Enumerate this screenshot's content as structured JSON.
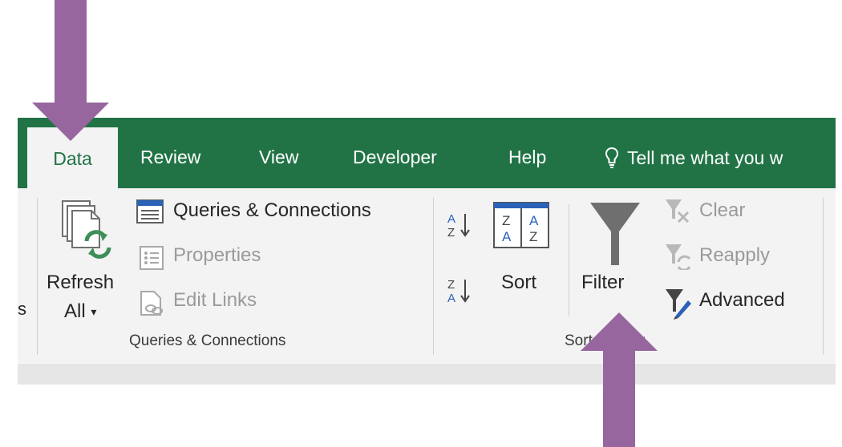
{
  "tabs": {
    "data": "Data",
    "review": "Review",
    "view": "View",
    "developer": "Developer",
    "help": "Help",
    "tell_me": "Tell me what you w"
  },
  "queries_group": {
    "refresh_line1": "Refresh",
    "refresh_line2": "All",
    "refresh_caret": "▾",
    "queries_connections": "Queries & Connections",
    "properties": "Properties",
    "edit_links": "Edit Links",
    "group_label": "Queries & Connections"
  },
  "sort_filter_group": {
    "sort": "Sort",
    "filter": "Filter",
    "clear": "Clear",
    "reapply": "Reapply",
    "advanced": "Advanced",
    "group_label": "Sort & Filter"
  },
  "left_cut_label": "s",
  "colors": {
    "ribbon_green": "#217346",
    "ribbon_bg": "#f3f3f3",
    "annotation_arrow": "#97669f",
    "sort_icon_blue": "#2a62b8"
  }
}
